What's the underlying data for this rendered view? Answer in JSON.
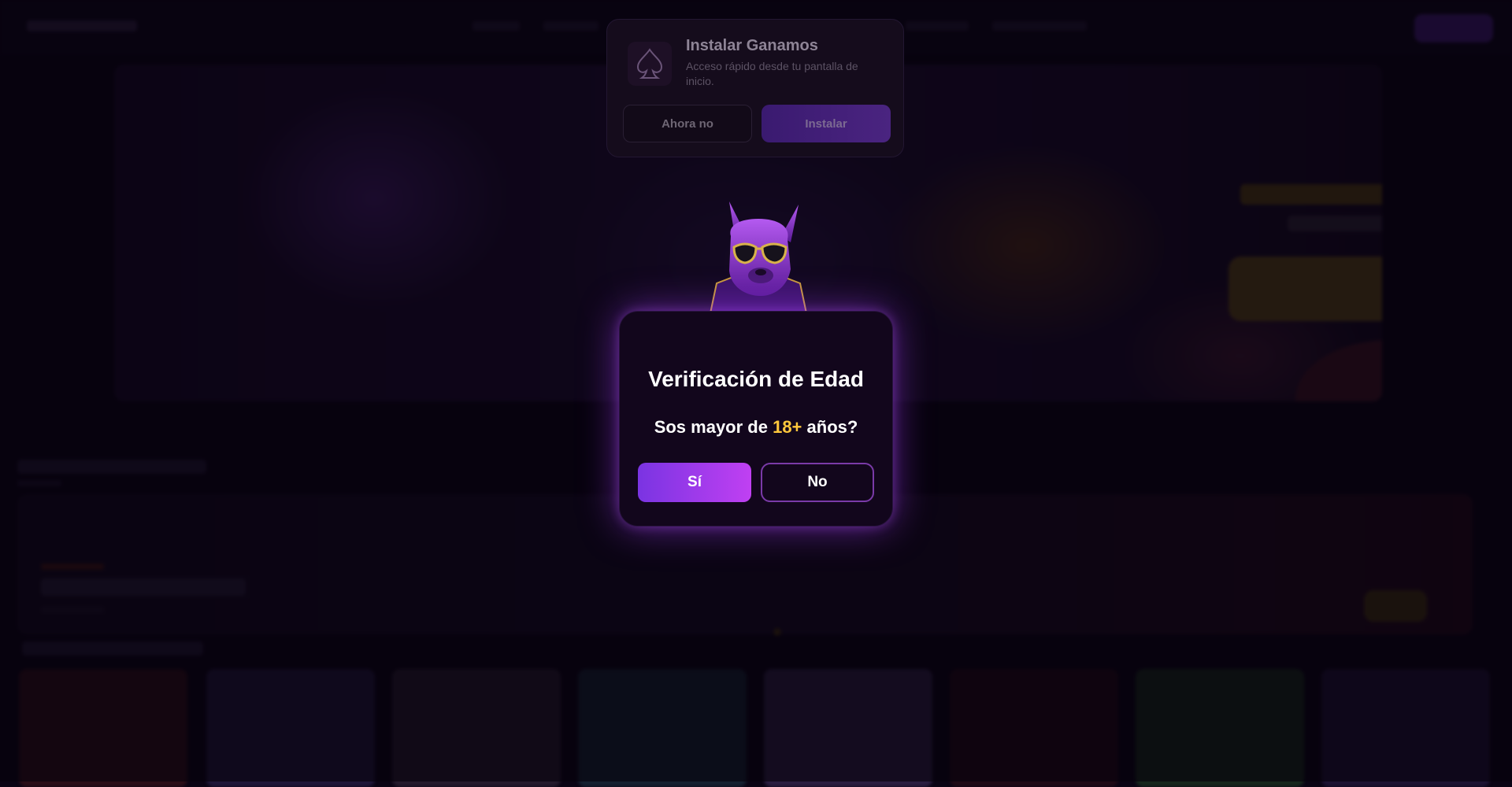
{
  "install_prompt": {
    "title": "Instalar Ganamos",
    "description": "Acceso rápido desde tu pantalla de inicio.",
    "later_label": "Ahora no",
    "install_label": "Instalar"
  },
  "age_modal": {
    "title": "Verificación de Edad",
    "question_prefix": "Sos mayor de ",
    "question_highlight": "18+",
    "question_suffix": " años?",
    "yes_label": "Sí",
    "no_label": "No"
  },
  "colors": {
    "accent": "#ffc83c",
    "primary_purple": "#a040f0",
    "background": "#0a0414"
  },
  "icons": {
    "app_icon": "spade-icon",
    "mascot": "dog-mascot-with-sunglasses"
  }
}
